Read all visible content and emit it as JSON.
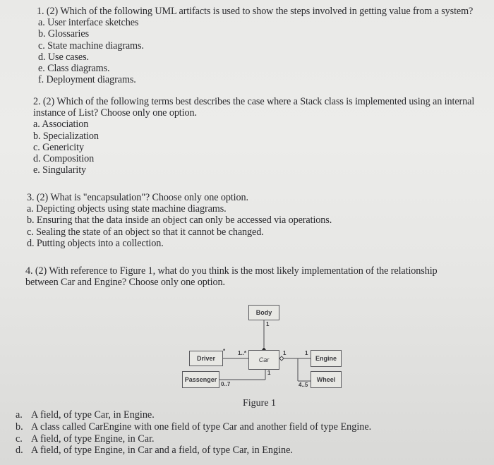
{
  "questions": [
    {
      "stem": "1. (2) Which of the following UML artifacts is used to show the steps involved in getting value from a system?",
      "options": [
        "a. User interface sketches",
        "b. Glossaries",
        "c. State machine diagrams.",
        "d. Use cases.",
        "e. Class diagrams.",
        "f. Deployment diagrams."
      ]
    },
    {
      "stem_line1": "2. (2) Which of the following terms best describes the case where a Stack class is implemented using an internal",
      "stem_line2": "instance of List? Choose only one option.",
      "options": [
        "a. Association",
        "b. Specialization",
        "c. Genericity",
        "d. Composition",
        "e. Singularity"
      ]
    },
    {
      "stem": "3. (2) What is \"encapsulation\"? Choose only one option.",
      "options": [
        "a. Depicting objects using state machine diagrams.",
        "b. Ensuring that the data inside an object can only be accessed via operations.",
        "c. Sealing the state of an object so that it cannot be changed.",
        "d. Putting objects into a collection."
      ]
    },
    {
      "stem_line1": "4. (2) With reference to Figure 1, what do you think is the most likely implementation of the relationship",
      "stem_line2": "between Car and Engine? Choose only one option.",
      "options": [
        {
          "letter": "a.",
          "text": "A field, of type Car, in Engine."
        },
        {
          "letter": "b.",
          "text": "A class called CarEngine with one field of type Car and another field of type Engine."
        },
        {
          "letter": "c.",
          "text": "A field, of type Engine, in Car."
        },
        {
          "letter": "d.",
          "text": "A field, of type Engine, in Car and a field, of type Car, in Engine."
        }
      ]
    }
  ],
  "figure": {
    "caption": "Figure 1",
    "classes": {
      "body": "Body",
      "car": "Car",
      "driver": "Driver",
      "passenger": "Passenger",
      "engine": "Engine",
      "wheel": "Wheel"
    },
    "multiplicities": {
      "body_car_body_end": "1",
      "driver_end": "*",
      "driver_car_car_end": "1..*",
      "car_passenger_car_end": "1",
      "passenger_end": "0..7",
      "car_engine_car_end": "1",
      "engine_end": "1",
      "wheel_end": "4..5"
    }
  }
}
